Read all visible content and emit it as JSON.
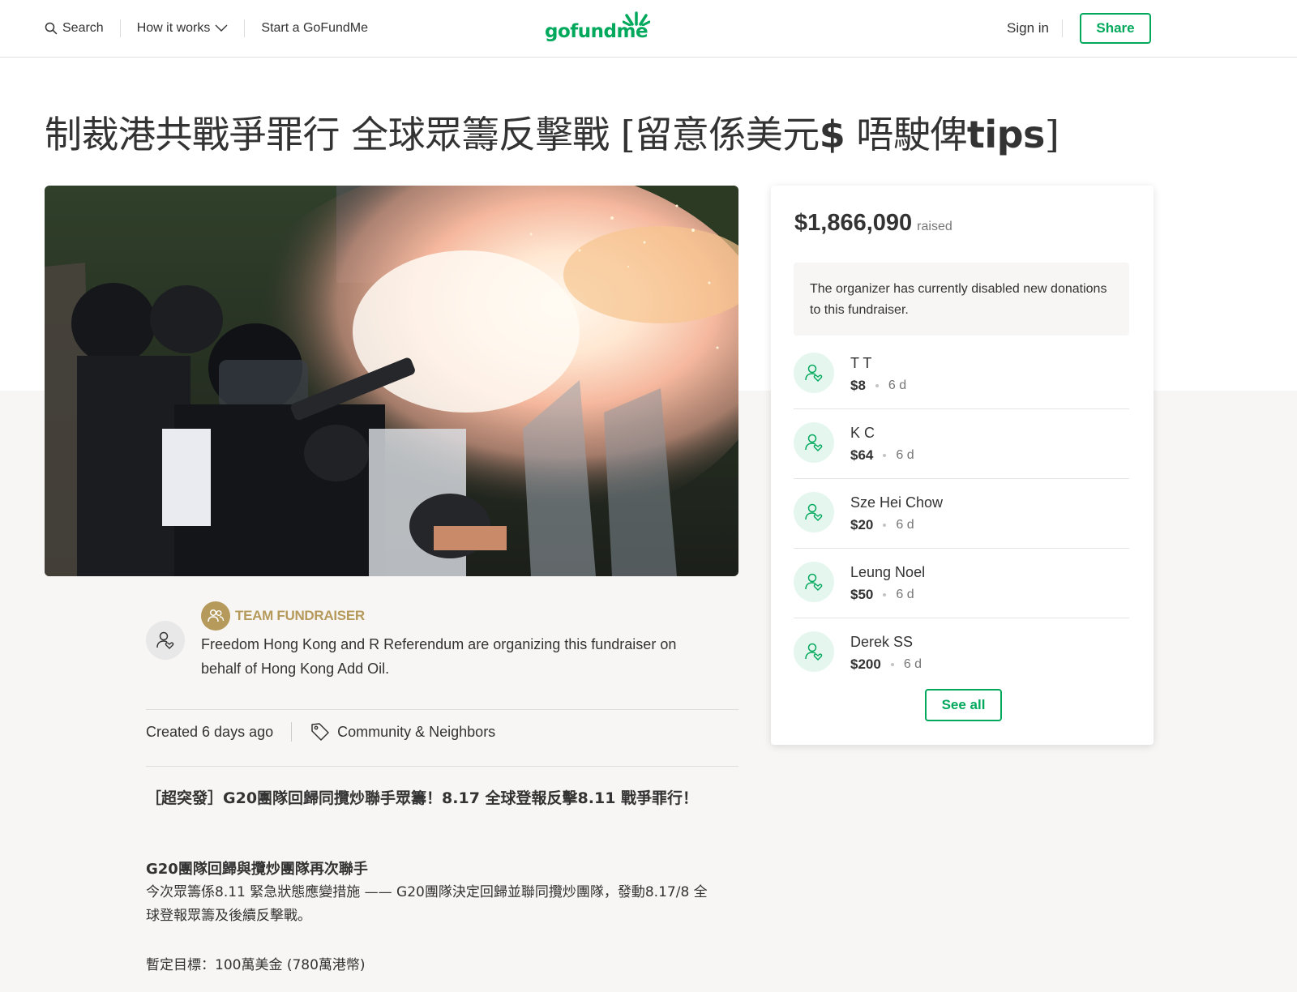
{
  "header": {
    "search_label": "Search",
    "how_it_works_label": "How it works",
    "start_label": "Start a GoFundMe",
    "logo_text": "gofundme",
    "signin_label": "Sign in",
    "share_label": "Share"
  },
  "campaign": {
    "title_part1": "制裁港共戰爭罪行 全球眾籌反擊戰 [留意係美元",
    "title_bold": "$",
    "title_part2": " 唔駛俾",
    "title_bold2": "tips",
    "title_part3": "]",
    "image_alt": "Police firing tear gas",
    "team_label": "TEAM FUNDRAISER",
    "organizer_text": "Freedom Hong Kong and R Referendum are organizing this fundraiser on behalf of Hong Kong Add Oil.",
    "created": "Created 6 days ago",
    "category": "Community & Neighbors",
    "story": {
      "headline": "［超突發］G20團隊回歸同攬炒聯手眾籌！8.17 全球登報反擊8.11 戰爭罪行！",
      "subhead": "G20團隊回歸與攬炒團隊再次聯手",
      "paragraph": "今次眾籌係8.11 緊急狀態應變措施 —— G20團隊決定回歸並聯同攬炒團隊，發動8.17/8 全球登報眾籌及後續反擊戰。",
      "target": "暫定目標：100萬美金 (780萬港幣)"
    }
  },
  "sidebar": {
    "raised_amount": "$1,866,090",
    "raised_label": "raised",
    "notice": "The organizer has currently disabled new donations to this fundraiser.",
    "donations": [
      {
        "name": "T T",
        "amount": "$8",
        "time": "6 d"
      },
      {
        "name": "K C",
        "amount": "$64",
        "time": "6 d"
      },
      {
        "name": "Sze Hei Chow",
        "amount": "$20",
        "time": "6 d"
      },
      {
        "name": "Leung Noel",
        "amount": "$50",
        "time": "6 d"
      },
      {
        "name": "Derek SS",
        "amount": "$200",
        "time": "6 d"
      }
    ],
    "see_all_label": "See all"
  },
  "colors": {
    "brand_green": "#02a95c",
    "team_gold": "#b59a5c",
    "page_bg_lower": "#f8f6f4"
  }
}
